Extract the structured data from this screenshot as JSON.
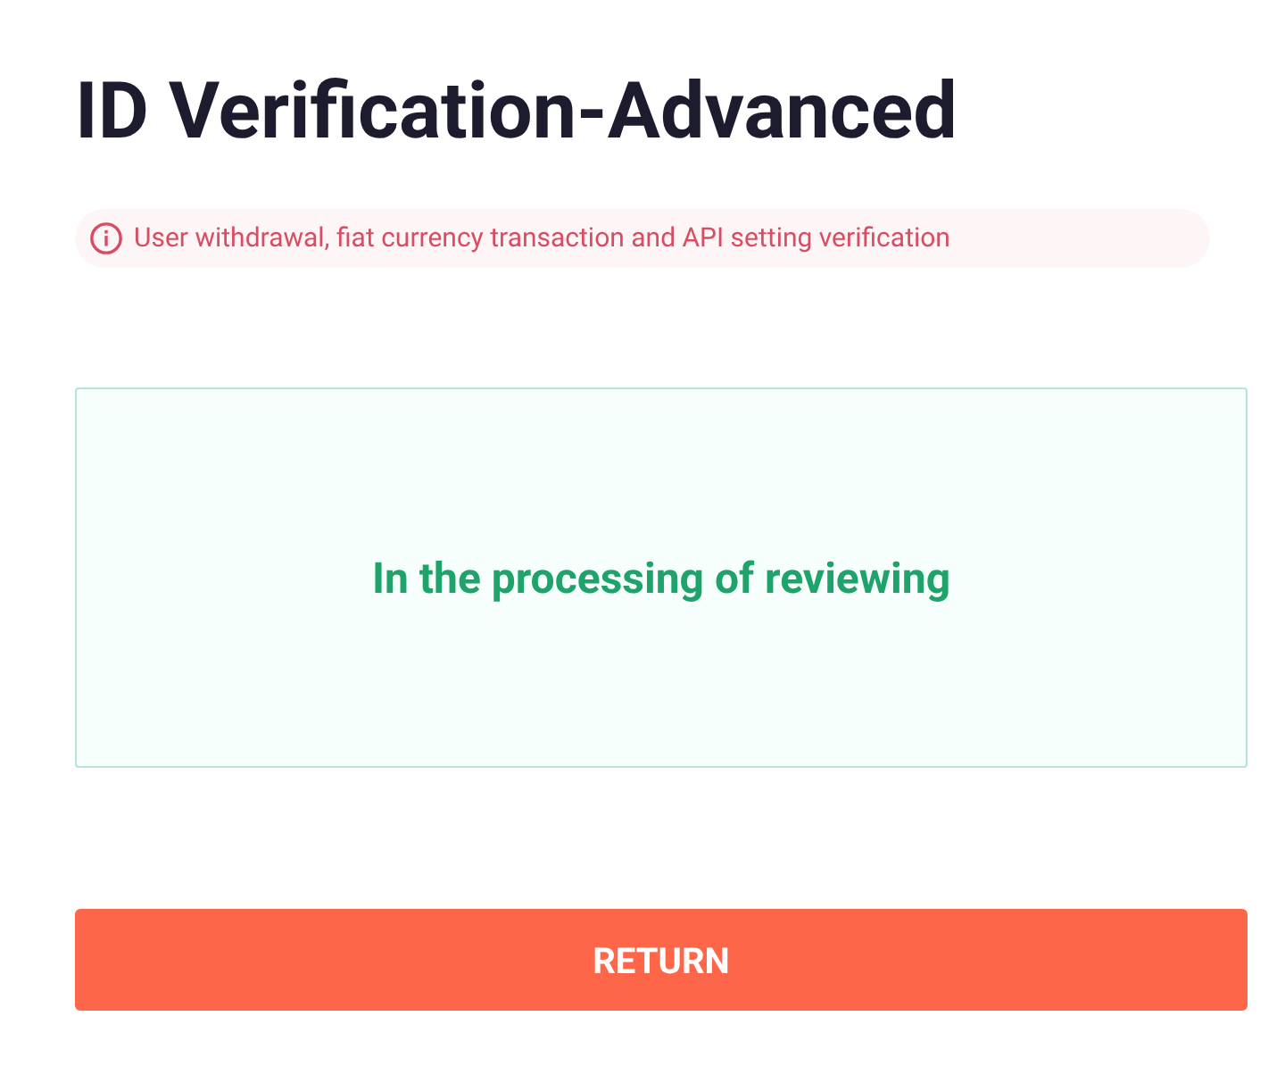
{
  "title": "ID Verification-Advanced",
  "notice": {
    "text": "User withdrawal, fiat currency transaction and API setting verification"
  },
  "status": {
    "text": "In the processing of reviewing"
  },
  "button": {
    "label": "RETURN"
  }
}
